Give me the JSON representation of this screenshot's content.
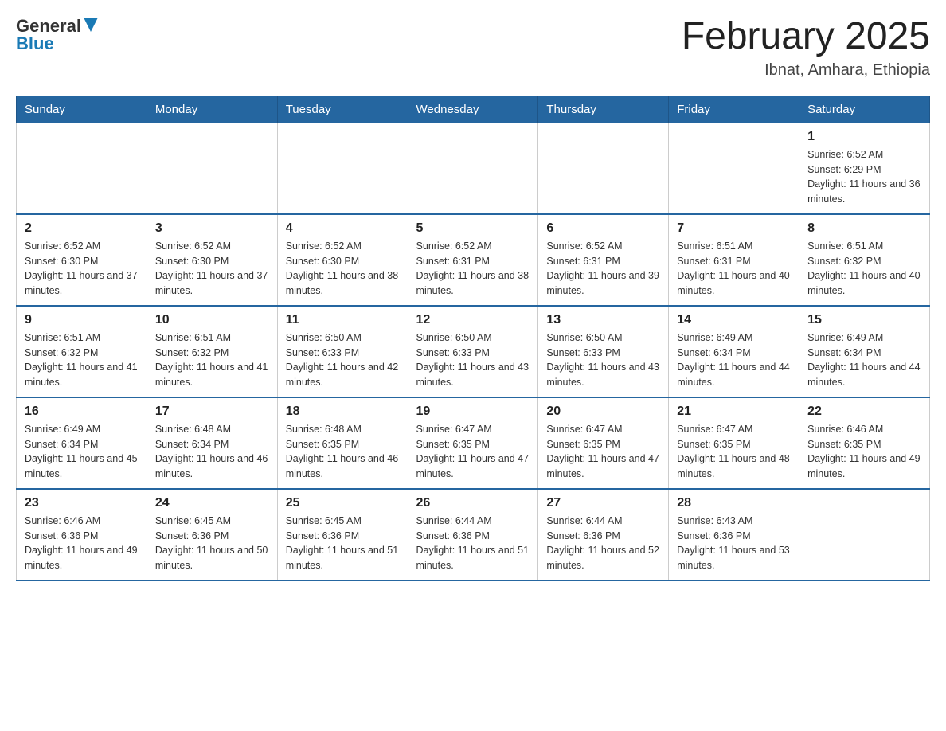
{
  "header": {
    "logo": {
      "text_general": "General",
      "text_blue": "Blue"
    },
    "title": "February 2025",
    "subtitle": "Ibnat, Amhara, Ethiopia"
  },
  "days_of_week": [
    "Sunday",
    "Monday",
    "Tuesday",
    "Wednesday",
    "Thursday",
    "Friday",
    "Saturday"
  ],
  "weeks": [
    [
      {
        "day": "",
        "sunrise": "",
        "sunset": "",
        "daylight": ""
      },
      {
        "day": "",
        "sunrise": "",
        "sunset": "",
        "daylight": ""
      },
      {
        "day": "",
        "sunrise": "",
        "sunset": "",
        "daylight": ""
      },
      {
        "day": "",
        "sunrise": "",
        "sunset": "",
        "daylight": ""
      },
      {
        "day": "",
        "sunrise": "",
        "sunset": "",
        "daylight": ""
      },
      {
        "day": "",
        "sunrise": "",
        "sunset": "",
        "daylight": ""
      },
      {
        "day": "1",
        "sunrise": "Sunrise: 6:52 AM",
        "sunset": "Sunset: 6:29 PM",
        "daylight": "Daylight: 11 hours and 36 minutes."
      }
    ],
    [
      {
        "day": "2",
        "sunrise": "Sunrise: 6:52 AM",
        "sunset": "Sunset: 6:30 PM",
        "daylight": "Daylight: 11 hours and 37 minutes."
      },
      {
        "day": "3",
        "sunrise": "Sunrise: 6:52 AM",
        "sunset": "Sunset: 6:30 PM",
        "daylight": "Daylight: 11 hours and 37 minutes."
      },
      {
        "day": "4",
        "sunrise": "Sunrise: 6:52 AM",
        "sunset": "Sunset: 6:30 PM",
        "daylight": "Daylight: 11 hours and 38 minutes."
      },
      {
        "day": "5",
        "sunrise": "Sunrise: 6:52 AM",
        "sunset": "Sunset: 6:31 PM",
        "daylight": "Daylight: 11 hours and 38 minutes."
      },
      {
        "day": "6",
        "sunrise": "Sunrise: 6:52 AM",
        "sunset": "Sunset: 6:31 PM",
        "daylight": "Daylight: 11 hours and 39 minutes."
      },
      {
        "day": "7",
        "sunrise": "Sunrise: 6:51 AM",
        "sunset": "Sunset: 6:31 PM",
        "daylight": "Daylight: 11 hours and 40 minutes."
      },
      {
        "day": "8",
        "sunrise": "Sunrise: 6:51 AM",
        "sunset": "Sunset: 6:32 PM",
        "daylight": "Daylight: 11 hours and 40 minutes."
      }
    ],
    [
      {
        "day": "9",
        "sunrise": "Sunrise: 6:51 AM",
        "sunset": "Sunset: 6:32 PM",
        "daylight": "Daylight: 11 hours and 41 minutes."
      },
      {
        "day": "10",
        "sunrise": "Sunrise: 6:51 AM",
        "sunset": "Sunset: 6:32 PM",
        "daylight": "Daylight: 11 hours and 41 minutes."
      },
      {
        "day": "11",
        "sunrise": "Sunrise: 6:50 AM",
        "sunset": "Sunset: 6:33 PM",
        "daylight": "Daylight: 11 hours and 42 minutes."
      },
      {
        "day": "12",
        "sunrise": "Sunrise: 6:50 AM",
        "sunset": "Sunset: 6:33 PM",
        "daylight": "Daylight: 11 hours and 43 minutes."
      },
      {
        "day": "13",
        "sunrise": "Sunrise: 6:50 AM",
        "sunset": "Sunset: 6:33 PM",
        "daylight": "Daylight: 11 hours and 43 minutes."
      },
      {
        "day": "14",
        "sunrise": "Sunrise: 6:49 AM",
        "sunset": "Sunset: 6:34 PM",
        "daylight": "Daylight: 11 hours and 44 minutes."
      },
      {
        "day": "15",
        "sunrise": "Sunrise: 6:49 AM",
        "sunset": "Sunset: 6:34 PM",
        "daylight": "Daylight: 11 hours and 44 minutes."
      }
    ],
    [
      {
        "day": "16",
        "sunrise": "Sunrise: 6:49 AM",
        "sunset": "Sunset: 6:34 PM",
        "daylight": "Daylight: 11 hours and 45 minutes."
      },
      {
        "day": "17",
        "sunrise": "Sunrise: 6:48 AM",
        "sunset": "Sunset: 6:34 PM",
        "daylight": "Daylight: 11 hours and 46 minutes."
      },
      {
        "day": "18",
        "sunrise": "Sunrise: 6:48 AM",
        "sunset": "Sunset: 6:35 PM",
        "daylight": "Daylight: 11 hours and 46 minutes."
      },
      {
        "day": "19",
        "sunrise": "Sunrise: 6:47 AM",
        "sunset": "Sunset: 6:35 PM",
        "daylight": "Daylight: 11 hours and 47 minutes."
      },
      {
        "day": "20",
        "sunrise": "Sunrise: 6:47 AM",
        "sunset": "Sunset: 6:35 PM",
        "daylight": "Daylight: 11 hours and 47 minutes."
      },
      {
        "day": "21",
        "sunrise": "Sunrise: 6:47 AM",
        "sunset": "Sunset: 6:35 PM",
        "daylight": "Daylight: 11 hours and 48 minutes."
      },
      {
        "day": "22",
        "sunrise": "Sunrise: 6:46 AM",
        "sunset": "Sunset: 6:35 PM",
        "daylight": "Daylight: 11 hours and 49 minutes."
      }
    ],
    [
      {
        "day": "23",
        "sunrise": "Sunrise: 6:46 AM",
        "sunset": "Sunset: 6:36 PM",
        "daylight": "Daylight: 11 hours and 49 minutes."
      },
      {
        "day": "24",
        "sunrise": "Sunrise: 6:45 AM",
        "sunset": "Sunset: 6:36 PM",
        "daylight": "Daylight: 11 hours and 50 minutes."
      },
      {
        "day": "25",
        "sunrise": "Sunrise: 6:45 AM",
        "sunset": "Sunset: 6:36 PM",
        "daylight": "Daylight: 11 hours and 51 minutes."
      },
      {
        "day": "26",
        "sunrise": "Sunrise: 6:44 AM",
        "sunset": "Sunset: 6:36 PM",
        "daylight": "Daylight: 11 hours and 51 minutes."
      },
      {
        "day": "27",
        "sunrise": "Sunrise: 6:44 AM",
        "sunset": "Sunset: 6:36 PM",
        "daylight": "Daylight: 11 hours and 52 minutes."
      },
      {
        "day": "28",
        "sunrise": "Sunrise: 6:43 AM",
        "sunset": "Sunset: 6:36 PM",
        "daylight": "Daylight: 11 hours and 53 minutes."
      },
      {
        "day": "",
        "sunrise": "",
        "sunset": "",
        "daylight": ""
      }
    ]
  ]
}
